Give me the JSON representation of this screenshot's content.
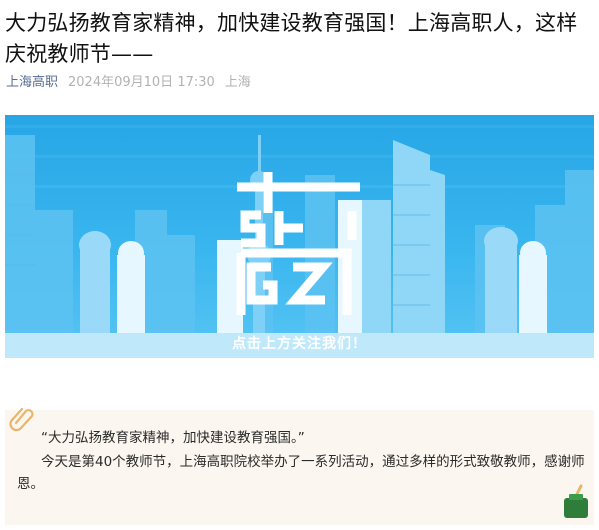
{
  "article": {
    "title": "大力弘扬教育家精神，加快建设教育强国！上海高职人，这样庆祝教师节——",
    "account": "上海高职",
    "datetime": "2024年09月10日 17:30",
    "location": "上海"
  },
  "banner": {
    "logo_text": "SHGZ",
    "caption": "点击上方关注我们！",
    "colors": {
      "sky": "#2aa8e8",
      "buildings": "#8fd6f7",
      "logo": "#ffffff"
    }
  },
  "intro": {
    "quote": "“大力弘扬教育家精神，加快建设教育强国。”",
    "paragraph": "今天是第40个教师节，上海高职院校举办了一系列活动，通过多样的形式致敬教师，感谢师恩。",
    "icons": [
      "paperclip-icon",
      "ink-bottle-icon"
    ],
    "colors": {
      "background": "#fbf6ef",
      "accent": "#e8b56b",
      "ink": "#2e7d3a"
    }
  }
}
